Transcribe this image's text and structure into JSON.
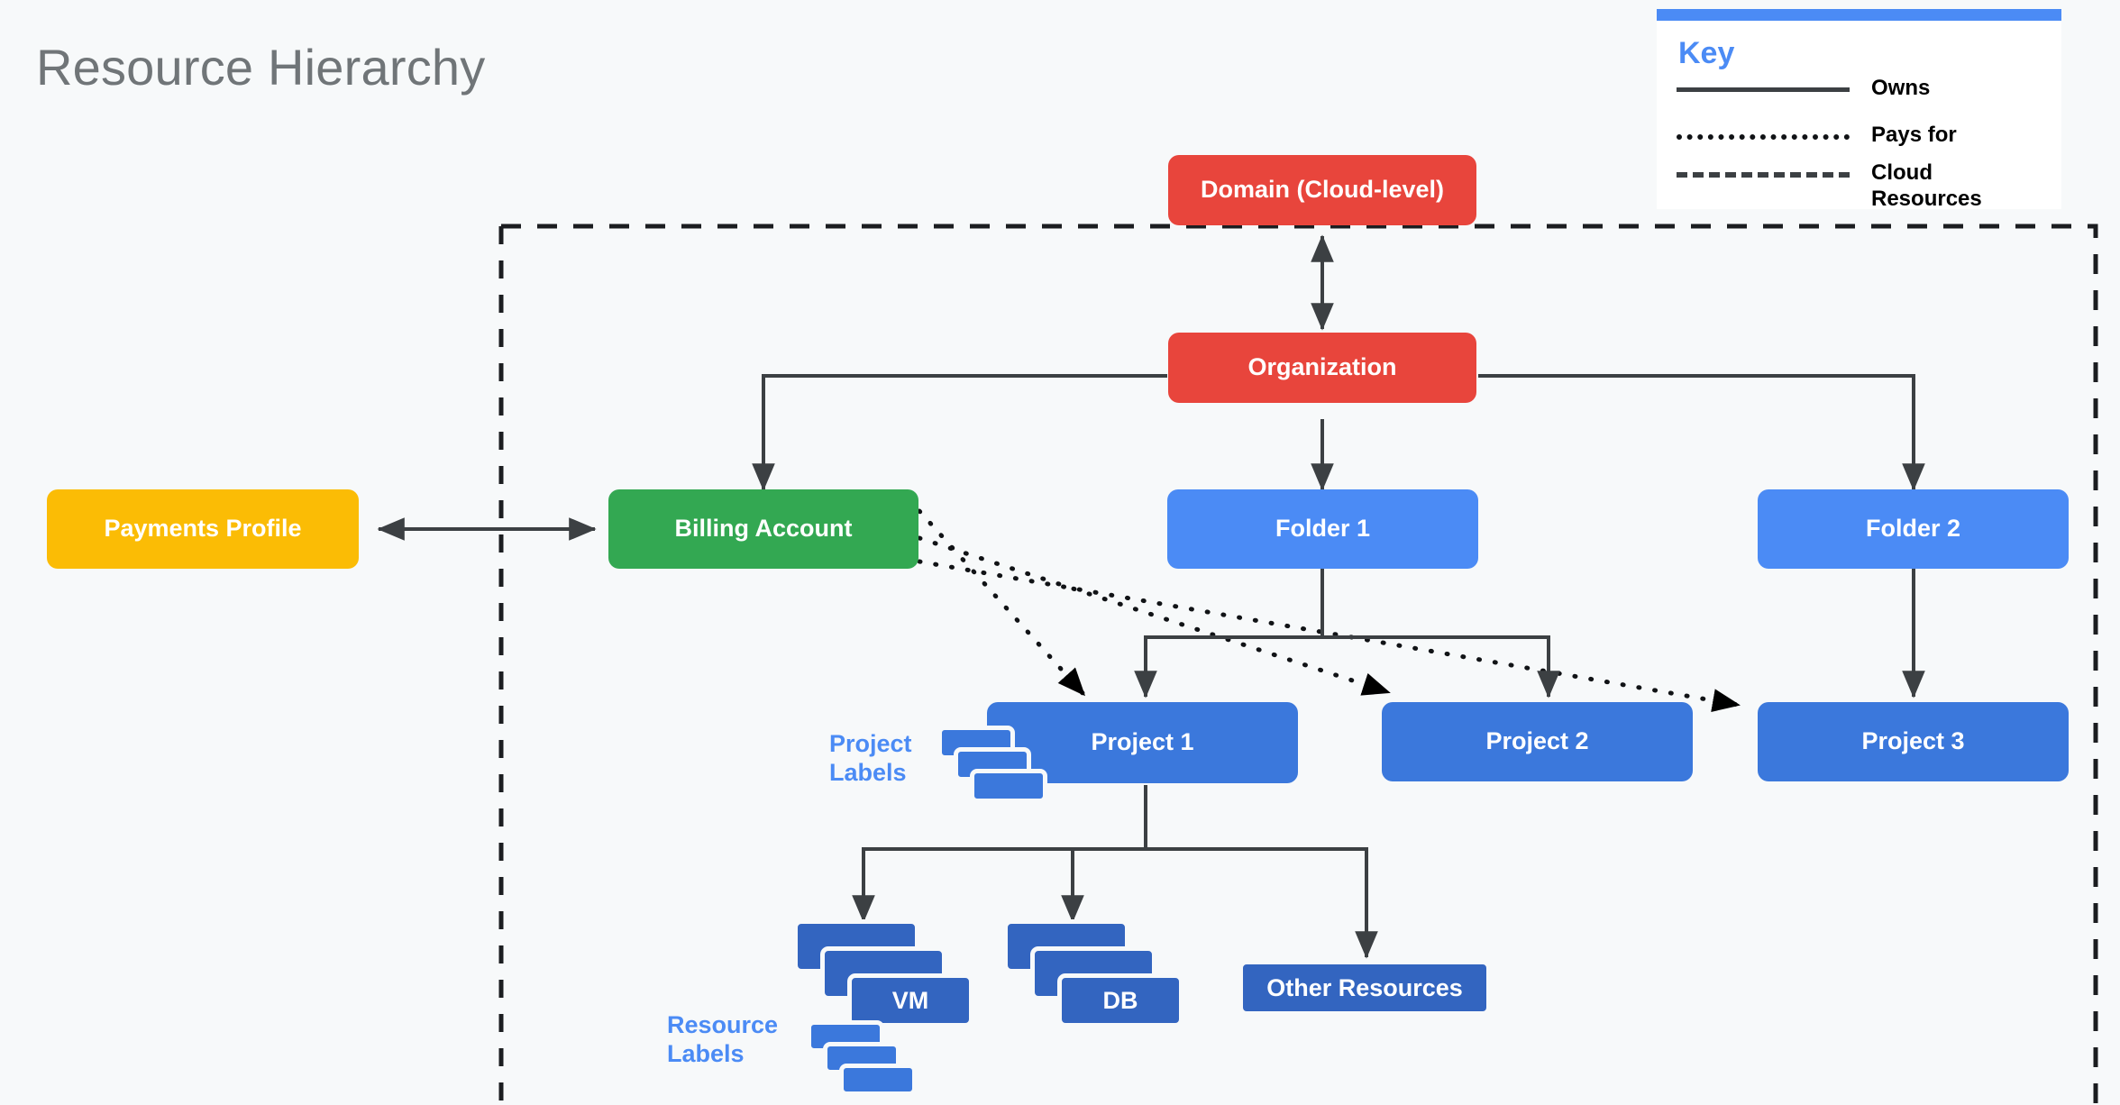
{
  "page": {
    "title": "Resource Hierarchy",
    "background_color": "#f7f9fa",
    "title_color": "#707578"
  },
  "key": {
    "title": "Key",
    "accent_color": "#4b8bf5",
    "rows": [
      {
        "style": "solid",
        "label": "Owns"
      },
      {
        "style": "dotted",
        "label": "Pays for"
      },
      {
        "style": "dashed",
        "label": "Cloud Resources"
      }
    ]
  },
  "nodes": {
    "domain": {
      "label": "Domain (Cloud-level)",
      "color": "#e8453c"
    },
    "organization": {
      "label": "Organization",
      "color": "#e8453c"
    },
    "payments_profile": {
      "label": "Payments Profile",
      "color": "#fbbc05"
    },
    "billing_account": {
      "label": "Billing Account",
      "color": "#33a852"
    },
    "folder_1": {
      "label": "Folder 1",
      "color": "#4b8bf5"
    },
    "folder_2": {
      "label": "Folder 2",
      "color": "#4b8bf5"
    },
    "project_1": {
      "label": "Project 1",
      "color": "#3b78dc"
    },
    "project_2": {
      "label": "Project 2",
      "color": "#3b78dc"
    },
    "project_3": {
      "label": "Project 3",
      "color": "#3b78dc"
    },
    "vm": {
      "label": "VM",
      "color": "#3365c0"
    },
    "db": {
      "label": "DB",
      "color": "#3365c0"
    },
    "other_resources": {
      "label": "Other Resources",
      "color": "#3365c0"
    }
  },
  "group_labels": {
    "project_labels": "Project\nLabels",
    "project_labels_line_1": "Project",
    "project_labels_line_2": "Labels",
    "resource_labels_line_1": "Resource",
    "resource_labels_line_2": "Labels",
    "color": "#4b8bf5"
  },
  "boundary": {
    "name": "cloud-resources-boundary",
    "style": "dashed",
    "color": "#1b1d20"
  },
  "relationships": [
    {
      "from": "domain",
      "to": "organization",
      "type": "owns",
      "arrow": "both"
    },
    {
      "from": "organization",
      "to": "billing_account",
      "type": "owns",
      "arrow": "end"
    },
    {
      "from": "organization",
      "to": "folder_1",
      "type": "owns",
      "arrow": "end"
    },
    {
      "from": "organization",
      "to": "folder_2",
      "type": "owns",
      "arrow": "end"
    },
    {
      "from": "payments_profile",
      "to": "billing_account",
      "type": "owns",
      "arrow": "both"
    },
    {
      "from": "billing_account",
      "to": "project_1",
      "type": "pays_for",
      "arrow": "end"
    },
    {
      "from": "billing_account",
      "to": "project_2",
      "type": "pays_for",
      "arrow": "end"
    },
    {
      "from": "billing_account",
      "to": "project_3",
      "type": "pays_for",
      "arrow": "end"
    },
    {
      "from": "folder_1",
      "to": "project_1",
      "type": "owns",
      "arrow": "end"
    },
    {
      "from": "folder_1",
      "to": "project_2",
      "type": "owns",
      "arrow": "end"
    },
    {
      "from": "folder_2",
      "to": "project_3",
      "type": "owns",
      "arrow": "end"
    },
    {
      "from": "project_1",
      "to": "vm",
      "type": "owns",
      "arrow": "end"
    },
    {
      "from": "project_1",
      "to": "db",
      "type": "owns",
      "arrow": "end"
    },
    {
      "from": "project_1",
      "to": "other_resources",
      "type": "owns",
      "arrow": "end"
    }
  ]
}
